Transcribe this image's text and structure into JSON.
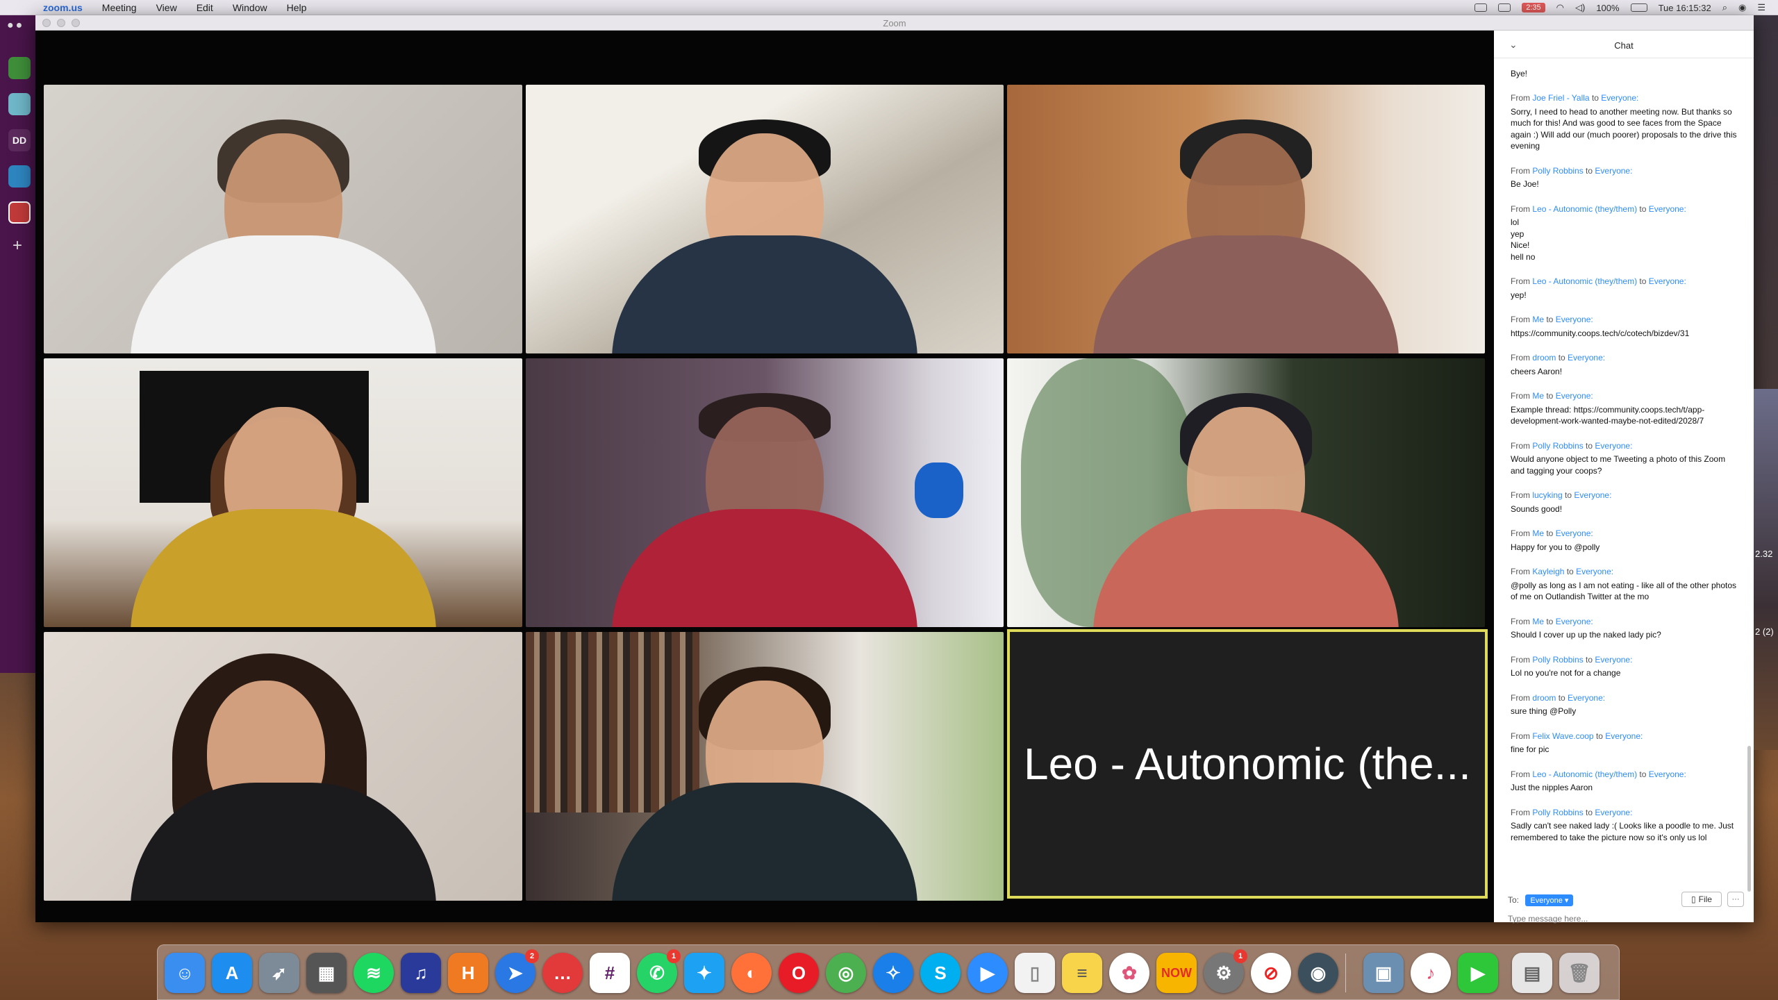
{
  "menubar": {
    "items": [
      "zoom.us",
      "Meeting",
      "View",
      "Edit",
      "Window",
      "Help"
    ],
    "recording": "2:35",
    "battery": "100%",
    "clock": "Tue 16:15:32"
  },
  "slack": {
    "workspace_initials": "DD"
  },
  "window": {
    "title": "Zoom"
  },
  "speaker": {
    "name": "Leo - Autonomic (the..."
  },
  "chat": {
    "title": "Chat",
    "messages": [
      {
        "from": "From Joe Friel - Yalla to ",
        "to": "Everyone:",
        "text": "Bye!"
      },
      {
        "from": "From ",
        "name": "Joe Friel - Yalla",
        "to": "Everyone:",
        "text": "Sorry, I need to head to another meeting now. But thanks so much for this! And was good to see faces from the Space again :) Will add our (much poorer) proposals to the drive this evening"
      },
      {
        "from": "From ",
        "name": "Polly Robbins",
        "to": "Everyone:",
        "text": "Be Joe!"
      },
      {
        "from": "From ",
        "name": "Leo - Autonomic (they/them)",
        "to": "Everyone:",
        "text": "lol\nyep\nNice!\nhell no"
      },
      {
        "from": "From ",
        "name": "Leo - Autonomic (they/them)",
        "to": "Everyone:",
        "text": "yep!"
      },
      {
        "from": "From ",
        "name": "Me",
        "to": "Everyone:",
        "text": "https://community.coops.tech/c/cotech/bizdev/31"
      },
      {
        "from": "From ",
        "name": "droom",
        "to": "Everyone:",
        "text": "cheers Aaron!"
      },
      {
        "from": "From ",
        "name": "Me",
        "to": "Everyone:",
        "text": "Example thread: https://community.coops.tech/t/app-development-work-wanted-maybe-not-edited/2028/7"
      },
      {
        "from": "From ",
        "name": "Polly Robbins",
        "to": "Everyone:",
        "text": "Would anyone object to me Tweeting a photo of this Zoom and tagging your coops?"
      },
      {
        "from": "From ",
        "name": "lucyking",
        "to": "Everyone:",
        "text": "Sounds good!"
      },
      {
        "from": "From ",
        "name": "Me",
        "to": "Everyone:",
        "text": "Happy for you to @polly"
      },
      {
        "from": "From ",
        "name": "Kayleigh",
        "to": "Everyone:",
        "text": "@polly as long as I am not eating - like all of the other photos of me on Outlandish Twitter at the mo"
      },
      {
        "from": "From ",
        "name": "Me",
        "to": "Everyone:",
        "text": "Should I cover up up the naked lady pic?"
      },
      {
        "from": "From ",
        "name": "Polly Robbins",
        "to": "Everyone:",
        "text": "Lol no you're not for a change"
      },
      {
        "from": "From ",
        "name": "droom",
        "to": "Everyone:",
        "text": "sure thing @Polly"
      },
      {
        "from": "From ",
        "name": "Felix Wave.coop",
        "to": "Everyone:",
        "text": "fine for pic"
      },
      {
        "from": "From ",
        "name": "Leo - Autonomic (they/them)",
        "to": "Everyone:",
        "text": "Just the nipples Aaron"
      },
      {
        "from": "From ",
        "name": "Polly Robbins",
        "to": "Everyone:",
        "text": "Sadly can't see naked lady :( Looks like a poodle to me. Just remembered to take the picture now so it's only us lol"
      }
    ],
    "to_label": "To:",
    "recipient": "Everyone",
    "file_label": "File",
    "more_label": "···",
    "input_placeholder": "Type message here..."
  },
  "dock": {
    "badges": {
      "airmail": "2",
      "whatsapp": "1",
      "prefs": "1"
    }
  },
  "side": {
    "text1": "2.32",
    "text2": "2 (2)"
  },
  "colors": {
    "accent": "#2d8cff",
    "active_speaker_border": "#dedb5a",
    "slack_bg": "#4a154b"
  }
}
